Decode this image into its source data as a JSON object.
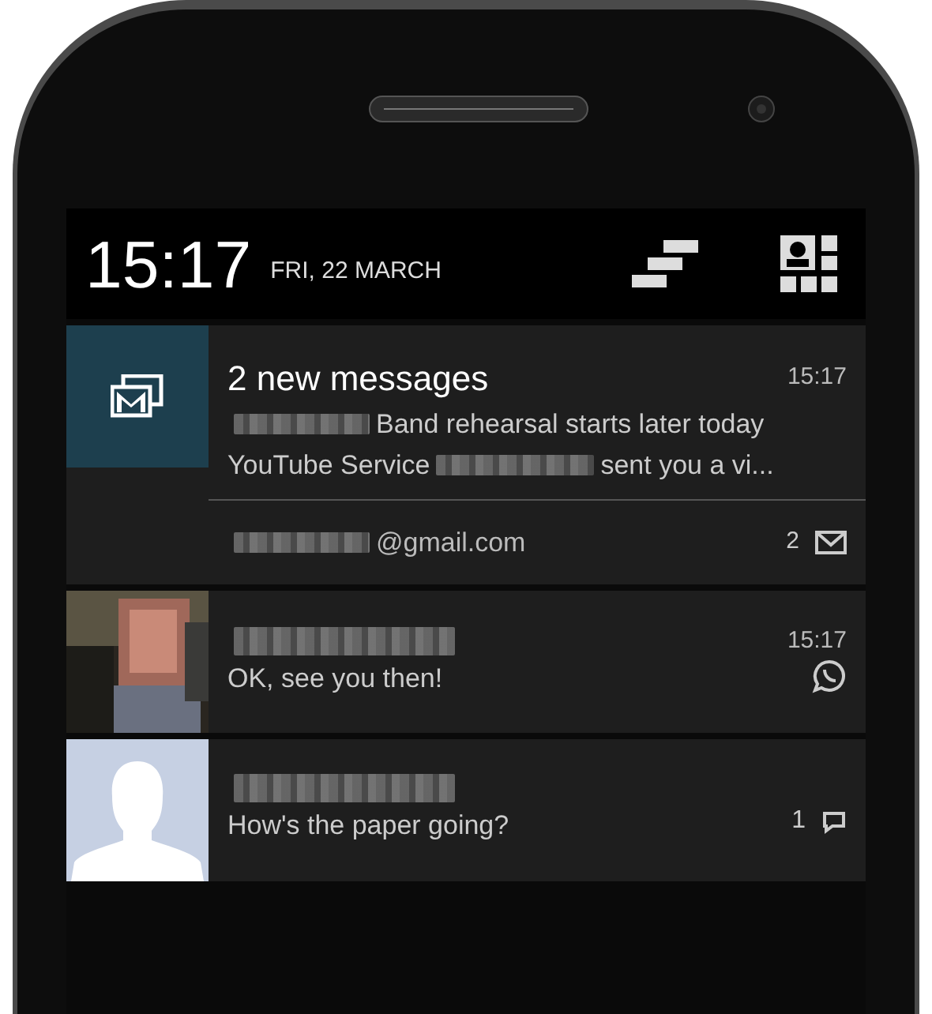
{
  "status_bar": {
    "time": "15:17",
    "date": "FRI, 22 MARCH"
  },
  "notifications": [
    {
      "kind": "email",
      "title": "2 new messages",
      "time": "15:17",
      "lines": [
        [
          {
            "kind": "blurred"
          },
          {
            "kind": "text",
            "text": "Band rehearsal starts later today"
          }
        ],
        [
          {
            "kind": "text",
            "text": "YouTube Service"
          },
          {
            "kind": "blurred"
          },
          {
            "kind": "text",
            "text": "sent you a vi..."
          }
        ]
      ],
      "footer": {
        "account": [
          {
            "kind": "blurred"
          },
          {
            "kind": "text",
            "text": "@gmail.com"
          }
        ],
        "count": "2"
      }
    },
    {
      "kind": "chat",
      "time": "15:17",
      "lines": [
        [
          {
            "kind": "text",
            "text": "OK, see you then!"
          }
        ]
      ]
    },
    {
      "kind": "sms",
      "lines": [
        [
          {
            "kind": "text",
            "text": "How's the paper going?"
          }
        ]
      ],
      "count": "1"
    }
  ]
}
